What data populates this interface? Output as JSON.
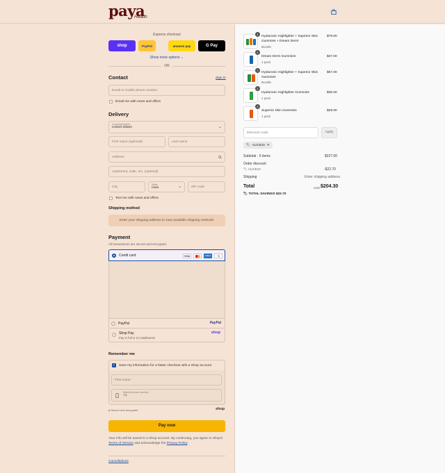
{
  "brand": {
    "name": "paya",
    "sub": "Health"
  },
  "express": {
    "title": "Express checkout",
    "buttons": [
      "shop",
      "PayPal",
      "amazon pay",
      "G Pay"
    ],
    "more": "Show more options",
    "or": "OR"
  },
  "contact": {
    "title": "Contact",
    "signin": "Sign in",
    "email_placeholder": "Email or mobile phone number",
    "news": "Email me with news and offers"
  },
  "delivery": {
    "title": "Delivery",
    "country_label": "Country/Region",
    "country": "United States",
    "first_name": "First name (optional)",
    "last_name": "Last name",
    "address": "Address",
    "apartment": "Apartment, suite, etc. (optional)",
    "city": "City",
    "state_label": "State",
    "state": "Iowa",
    "zip": "ZIP code",
    "text_news": "Text me with news and offers"
  },
  "shipping": {
    "title": "Shipping method",
    "notice": "Enter your shipping address to view available shipping methods."
  },
  "payment": {
    "title": "Payment",
    "subtitle": "All transactions are secure and encrypted.",
    "credit_card": "Credit card",
    "cards": [
      "VISA",
      "MC",
      "AMEX",
      "+5"
    ],
    "paypal": "PayPal",
    "paypal_logo": "PayPal",
    "shoppay": "Shop Pay",
    "shoppay_sub": "Pay in full or in installments",
    "shoppay_logo": "shop"
  },
  "remember": {
    "title": "Remember me",
    "save": "Save my information for a faster checkout with a Shop account",
    "first_name": "First name",
    "phone_label": "Mobile phone number",
    "phone_value": "+1",
    "secure": "Secure and encrypted",
    "shop_logo": "shop"
  },
  "paynow": "Pay now",
  "legal": {
    "text1": "Your info will be saved to a Shop account. By continuing, you agree to Shop's",
    "terms": "Terms of Service",
    "text2": "and acknowledge the",
    "privacy": "Privacy Policy",
    "cancellations": "Cancellations"
  },
  "cart": {
    "items": [
      {
        "qty": "1",
        "title": "Hyaluronic Highlighter + Superior Skin Gummies + Dream Derm",
        "sub": "Bundle",
        "price": "$79.00"
      },
      {
        "qty": "1",
        "title": "Dream Derm Gummies",
        "sub": "1 pack",
        "price": "$27.00"
      },
      {
        "qty": "1",
        "title": "Hyaluronic Highlighter + Superior Skin Gummies",
        "sub": "Bundle",
        "price": "$57.00"
      },
      {
        "qty": "1",
        "title": "Hyaluronic Highlighter Gummies",
        "sub": "1 pack",
        "price": "$35.00"
      },
      {
        "qty": "1",
        "title": "Superior Skin Gummies",
        "sub": "1 pack",
        "price": "$29.00"
      }
    ],
    "discount_placeholder": "Discount code",
    "apply": "Apply",
    "code_tag": "ALICE10",
    "subtotal_label": "Subtotal · 5 items",
    "subtotal": "$227.00",
    "order_discount": "Order discount",
    "discount_code": "ALICE10",
    "discount_value": "-$22.70",
    "shipping_label": "Shipping",
    "shipping_value": "Enter shipping address",
    "total_label": "Total",
    "currency": "USD",
    "total": "$204.30",
    "savings_label": "TOTAL SAVINGS",
    "savings": "$22.70"
  }
}
